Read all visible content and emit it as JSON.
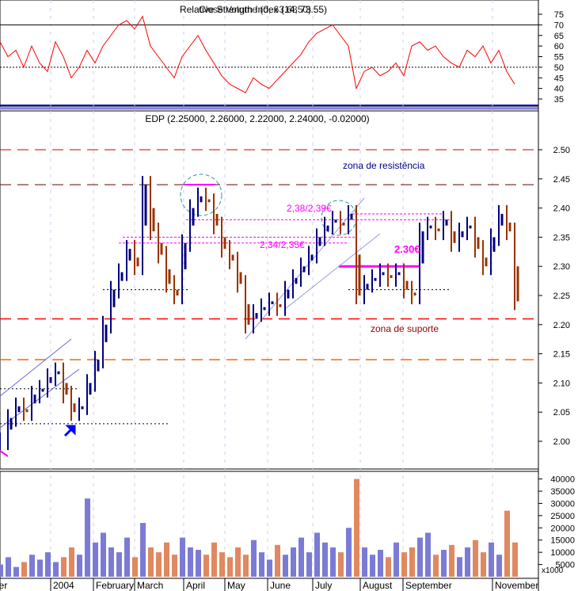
{
  "chart_data": [
    {
      "type": "line",
      "panel": "rsi",
      "title_overlap_a": "Relative Strength Index (14, 73.55)",
      "title_overlap_b": "Close Volume (0, 63.6850)",
      "ylim": [
        30,
        80
      ],
      "yticks": [
        35,
        40,
        45,
        50,
        55,
        60,
        65,
        70,
        75
      ],
      "reference_lines": [
        30,
        50,
        70
      ],
      "color": "#ff0000",
      "values": [
        62,
        55,
        58,
        50,
        60,
        52,
        48,
        62,
        55,
        45,
        50,
        58,
        52,
        60,
        65,
        70,
        72,
        68,
        74,
        60,
        55,
        50,
        45,
        55,
        60,
        65,
        58,
        52,
        46,
        42,
        40,
        38,
        45,
        42,
        40,
        44,
        48,
        52,
        56,
        62,
        66,
        68,
        70,
        65,
        60,
        40,
        48,
        50,
        46,
        48,
        52,
        46,
        60,
        62,
        58,
        60,
        55,
        52,
        50,
        58,
        55,
        60,
        52,
        58,
        48,
        42
      ]
    },
    {
      "type": "bar",
      "panel": "price",
      "title": "EDP (2.25000, 2.26000, 2.22000, 2.24000, -0.02000)",
      "ylim": [
        1.95,
        2.55
      ],
      "yticks": [
        "2.00",
        "2.05",
        "2.10",
        "2.15",
        "2.20",
        "2.25",
        "2.30",
        "2.35",
        "2.40",
        "2.45",
        "2.50"
      ],
      "up_color": "#000080",
      "down_color": "#993300",
      "close": [
        2.0,
        2.04,
        2.06,
        2.05,
        2.08,
        2.09,
        2.11,
        2.12,
        2.08,
        2.05,
        2.06,
        2.1,
        2.14,
        2.2,
        2.26,
        2.29,
        2.33,
        2.3,
        2.44,
        2.36,
        2.32,
        2.27,
        2.25,
        2.34,
        2.4,
        2.42,
        2.41,
        2.37,
        2.33,
        2.31,
        2.27,
        2.2,
        2.22,
        2.23,
        2.24,
        2.23,
        2.26,
        2.28,
        2.3,
        2.32,
        2.35,
        2.37,
        2.38,
        2.37,
        2.39,
        2.25,
        2.27,
        2.28,
        2.29,
        2.28,
        2.29,
        2.26,
        2.25,
        2.36,
        2.37,
        2.36,
        2.38,
        2.34,
        2.36,
        2.37,
        2.33,
        2.3,
        2.35,
        2.39,
        2.36,
        2.24
      ],
      "levels": [
        {
          "value": 2.5,
          "color": "#cc0000",
          "style": "long-dash"
        },
        {
          "value": 2.44,
          "color": "#660000",
          "style": "long-dash"
        },
        {
          "value": 2.21,
          "color": "#ff0000",
          "style": "long-dash"
        },
        {
          "value": 2.14,
          "color": "#ff6600",
          "style": "long-dash"
        }
      ],
      "annotations": {
        "resistance": "zona de resistência",
        "support": "zona de suporte",
        "label_2_38": "2,38/2,39€",
        "label_2_34": "2,34/2,35€",
        "label_2_30": "2.30€"
      },
      "annotation_colors": {
        "resistance": "#000080",
        "support": "#990000",
        "levels": "#ff00ff"
      }
    },
    {
      "type": "bar",
      "panel": "volume",
      "ylim": [
        0,
        43000
      ],
      "yticks": [
        "5000",
        "10000",
        "15000",
        "20000",
        "25000",
        "30000",
        "35000",
        "40000"
      ],
      "unit_label": "x1000",
      "up_color": "#7b7bd6",
      "down_color": "#e08860",
      "values_thousands": [
        5,
        8,
        4,
        6,
        9,
        7,
        10,
        6,
        8,
        12,
        9,
        32,
        14,
        18,
        12,
        10,
        16,
        8,
        22,
        12,
        10,
        14,
        9,
        16,
        12,
        11,
        9,
        14,
        10,
        8,
        12,
        9,
        15,
        10,
        7,
        13,
        9,
        12,
        16,
        10,
        18,
        14,
        12,
        10,
        20,
        40,
        12,
        9,
        11,
        8,
        14,
        10,
        12,
        16,
        18,
        9,
        11,
        13,
        8,
        12,
        15,
        10,
        14,
        9,
        27,
        14
      ]
    }
  ],
  "xaxis": {
    "months": [
      "ber",
      "2004",
      "February",
      "March",
      "April",
      "May",
      "June",
      "July",
      "August",
      "September",
      "November"
    ]
  }
}
